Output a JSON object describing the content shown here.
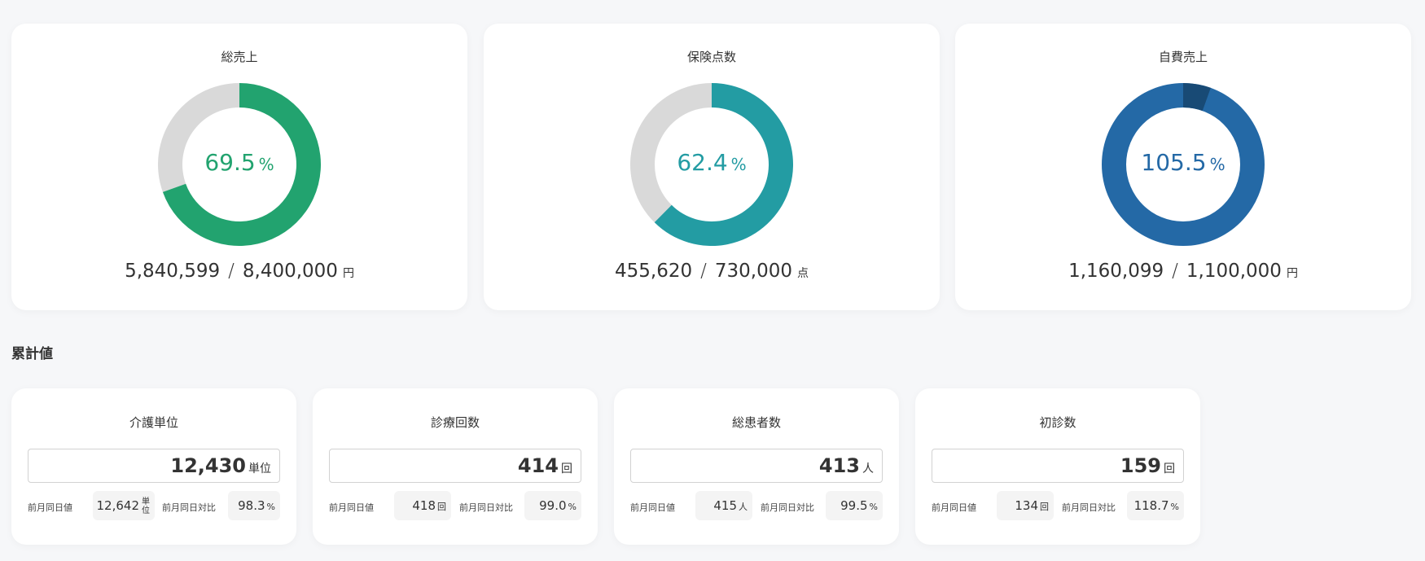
{
  "donuts": [
    {
      "title": "総売上",
      "percent": "69.5",
      "percent_unit": "%",
      "percent_value": 69.5,
      "color": "#22a36f",
      "over_color": "#22a36f",
      "remainder_color": "#d9d9d9",
      "actual": "5,840,599",
      "separator": "/",
      "target": "8,400,000",
      "unit": "円"
    },
    {
      "title": "保険点数",
      "percent": "62.4",
      "percent_unit": "%",
      "percent_value": 62.4,
      "color": "#239ca3",
      "over_color": "#239ca3",
      "remainder_color": "#d9d9d9",
      "actual": "455,620",
      "separator": "/",
      "target": "730,000",
      "unit": "点"
    },
    {
      "title": "自費売上",
      "percent": "105.5",
      "percent_unit": "%",
      "percent_value": 105.5,
      "color": "#2469a6",
      "over_color": "#184a75",
      "remainder_color": "#d9d9d9",
      "actual": "1,160,099",
      "separator": "/",
      "target": "1,100,000",
      "unit": "円"
    }
  ],
  "section_title": "累計値",
  "metrics": [
    {
      "title": "介護単位",
      "value": "12,430",
      "unit": "単位",
      "prev_label": "前月同日値",
      "prev_value": "12,642",
      "prev_unit_top": "単",
      "prev_unit_bottom": "位",
      "ratio_label": "前月同日対比",
      "ratio_value": "98.3",
      "ratio_unit": "%"
    },
    {
      "title": "診療回数",
      "value": "414",
      "unit": "回",
      "prev_label": "前月同日値",
      "prev_value": "418",
      "prev_unit": "回",
      "ratio_label": "前月同日対比",
      "ratio_value": "99.0",
      "ratio_unit": "%"
    },
    {
      "title": "総患者数",
      "value": "413",
      "unit": "人",
      "prev_label": "前月同日値",
      "prev_value": "415",
      "prev_unit": "人",
      "ratio_label": "前月同日対比",
      "ratio_value": "99.5",
      "ratio_unit": "%"
    },
    {
      "title": "初診数",
      "value": "159",
      "unit": "回",
      "prev_label": "前月同日値",
      "prev_value": "134",
      "prev_unit": "回",
      "ratio_label": "前月同日対比",
      "ratio_value": "118.7",
      "ratio_unit": "%"
    }
  ]
}
